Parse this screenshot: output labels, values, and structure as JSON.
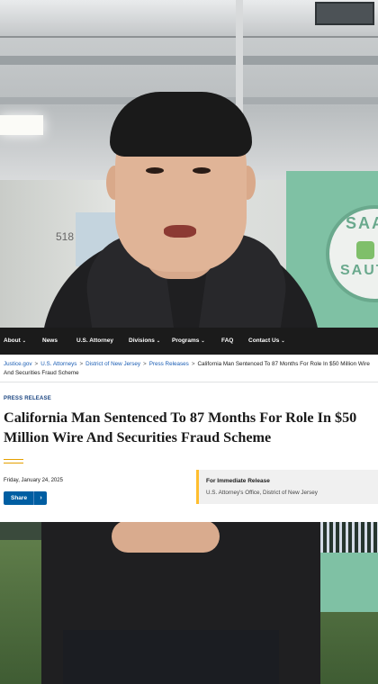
{
  "nav": {
    "items": [
      {
        "label": "About",
        "caret": "⌄"
      },
      {
        "label": "News",
        "caret": ""
      },
      {
        "label": "U.S. Attorney",
        "caret": ""
      },
      {
        "label": "Divisions",
        "caret": "⌄"
      },
      {
        "label": "Programs",
        "caret": "⌄"
      },
      {
        "label": "FAQ",
        "caret": ""
      },
      {
        "label": "Contact Us",
        "caret": "⌄"
      }
    ]
  },
  "breadcrumb": {
    "items": [
      "Justice.gov",
      "U.S. Attorneys",
      "District of New Jersey",
      "Press Releases"
    ],
    "separator": ">",
    "current": "California Man Sentenced To 87 Months For Role In $50 Million Wire And Securities Fraud Scheme"
  },
  "article": {
    "eyebrow": "PRESS RELEASE",
    "title": "California Man Sentenced To 87 Months For Role In $50 Million Wire And Securities Fraud Scheme",
    "date": "Friday, January 24, 2025",
    "share_label": "Share",
    "share_icon": "chevron-right-icon",
    "release_title": "For Immediate Release",
    "release_office": "U.S. Attorney's Office, District of New Jersey"
  },
  "background": {
    "wall_number": "518",
    "banner_text_top": "SAA",
    "banner_text_bottom": "SAUT"
  },
  "colors": {
    "nav_bg": "#1b1b1b",
    "link": "#1a5db4",
    "eyebrow": "#1a4480",
    "share_button": "#005ea2",
    "accent_gold": "#ffbe2e",
    "release_bg": "#f0f0f0"
  }
}
